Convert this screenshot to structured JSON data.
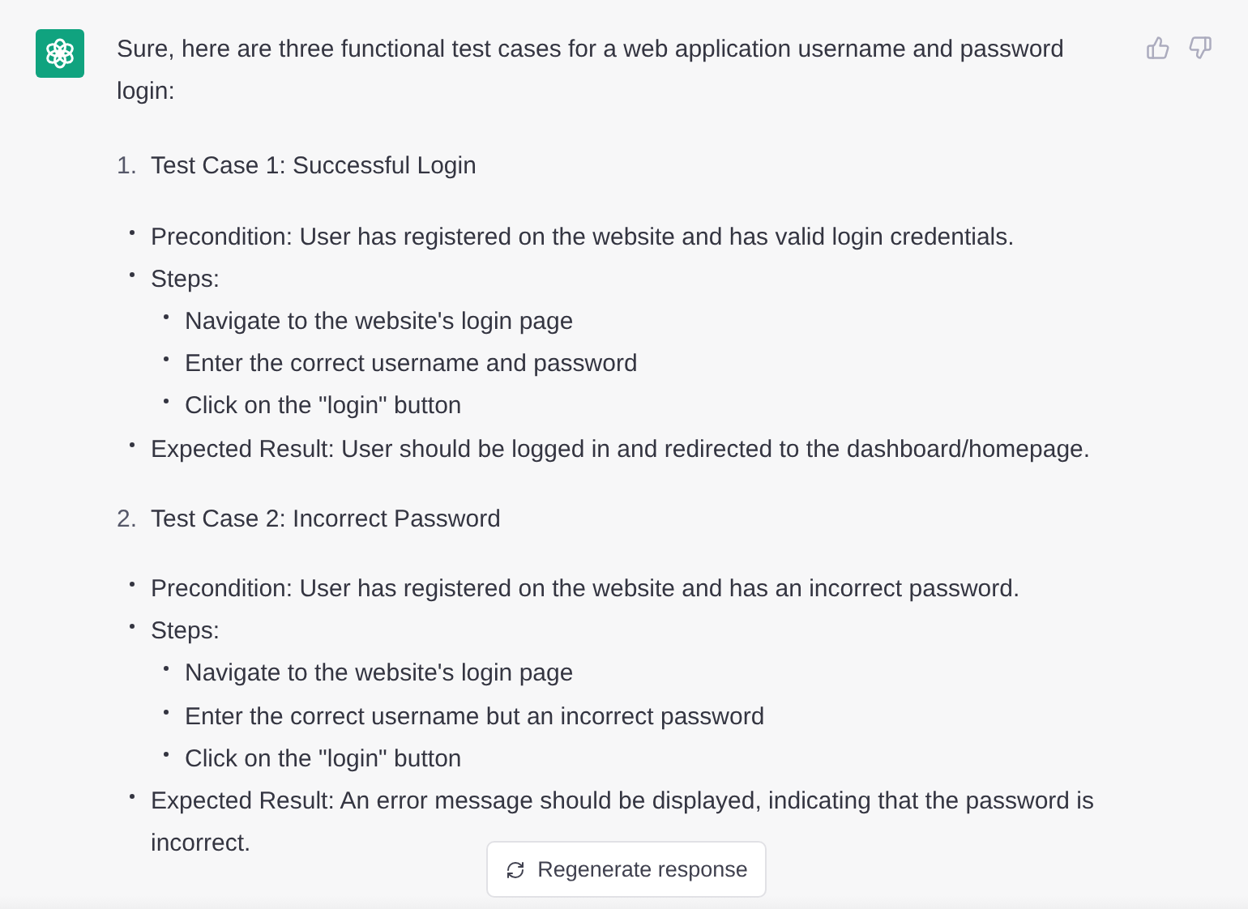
{
  "message": {
    "intro": "Sure, here are three functional test cases for a web application username and password login:",
    "test_cases": [
      {
        "number": "1.",
        "title": "Test Case 1: Successful Login",
        "details": [
          {
            "text": "Precondition: User has registered on the website and has valid login credentials."
          },
          {
            "text": "Steps:",
            "children": [
              {
                "text": "Navigate to the website's login page"
              },
              {
                "text": "Enter the correct username and password"
              },
              {
                "text": "Click on the \"login\" button"
              }
            ]
          },
          {
            "text": "Expected Result: User should be logged in and redirected to the dashboard/homepage."
          }
        ]
      },
      {
        "number": "2.",
        "title": "Test Case 2: Incorrect Password",
        "details": [
          {
            "text": "Precondition: User has registered on the website and has an incorrect password."
          },
          {
            "text": "Steps:",
            "children": [
              {
                "text": "Navigate to the website's login page"
              },
              {
                "text": "Enter the correct username but an incorrect password"
              },
              {
                "text": "Click on the \"login\" button"
              }
            ]
          },
          {
            "text": "Expected Result: An error message should be displayed, indicating that the password is incorrect."
          }
        ]
      }
    ]
  },
  "regenerate_button": "Regenerate response"
}
